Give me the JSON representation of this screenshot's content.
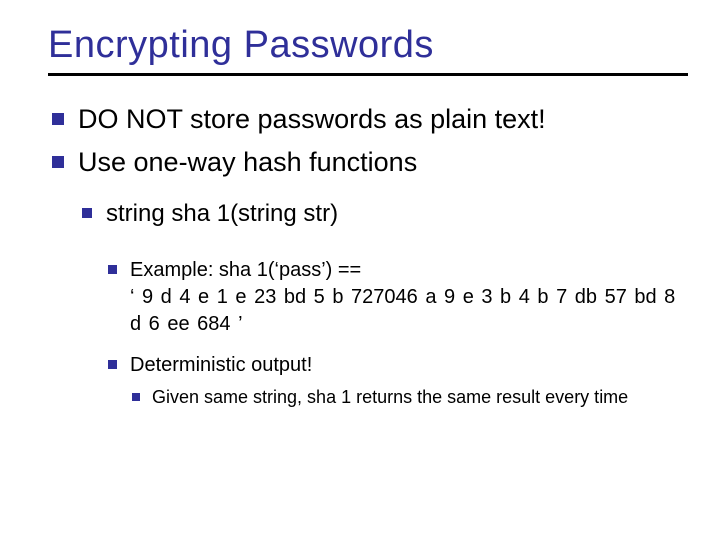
{
  "title": "Encrypting Passwords",
  "bullets": {
    "b1": "DO NOT store passwords as plain text!",
    "b2": "Use one-way hash functions",
    "b2_1": "string sha 1(string str)",
    "b2_2_line1": "Example: sha 1(‘pass’) ==",
    "b2_2_line2": "‘ 9 d 4 e 1 e 23 bd 5 b 727046 a 9 e 3 b 4 b 7 db 57 bd 8 d 6 ee 684 ’",
    "b2_3": "Deterministic output!",
    "b2_3_1": "Given same string, sha 1 returns the same result every time"
  }
}
